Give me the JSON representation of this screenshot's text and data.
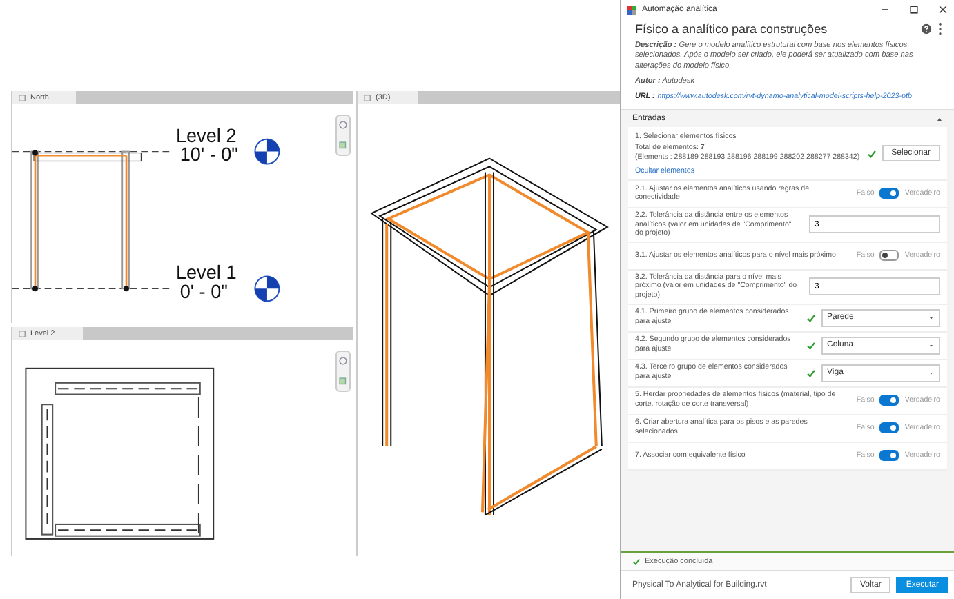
{
  "views": [
    {
      "kind": "elevation",
      "tab": "North",
      "levels": [
        {
          "name": "Level 2",
          "elevation": "10' - 0\""
        },
        {
          "name": "Level 1",
          "elevation": "0' - 0\""
        }
      ]
    },
    {
      "kind": "plan",
      "tab": "Level 2"
    },
    {
      "kind": "perspective",
      "tab": "(3D)"
    }
  ],
  "panel": {
    "window_title": "Automação analítica",
    "title": "Físico a analítico para construções",
    "description": "**Descrição :** Gere o modelo analítico estrutural com base nos elementos físicos selecionados. Após o modelo ser criado, ele poderá ser atualizado com base nas alterações do modelo físico.",
    "author": "**Autor :** Autodesk",
    "url_label": "URL :",
    "url": "https://www.autodesk.com/rvt-dynamo-analytical-model-scripts-help-2023-ptb",
    "section": {
      "title": "Entradas",
      "expanded": true
    },
    "inputs": [
      {
        "kind": "select",
        "label": "1. Selecionar elementos físicos",
        "total": "Total de elementos: **7**",
        "elements": "(Elements : 288189 288193 288196 288199 288202 288277 288342)",
        "link": "Ocultar elementos",
        "button": "Selecionar"
      },
      {
        "kind": "toggle",
        "label": "2.1. Ajustar os elementos analíticos usando regras de conectividade",
        "off_label": "Falso",
        "on_label": "Verdadeiro",
        "on": true
      },
      {
        "kind": "number",
        "label": "2.2. Tolerância da distância entre os elementos analíticos (valor em unidades de \"Comprimento\" do projeto)",
        "value": "3"
      },
      {
        "kind": "toggle",
        "label": "3.1. Ajustar os elementos analíticos para o nível mais próximo",
        "off_label": "Falso",
        "on_label": "Verdadeiro",
        "on": false
      },
      {
        "kind": "number",
        "label": "3.2. Tolerância da distância para o nível mais próximo (valor em unidades de \"Comprimento\" do projeto)",
        "value": "3"
      },
      {
        "kind": "dropdown",
        "label": "4.1. Primeiro grupo de elementos considerados para ajuste",
        "value": "Parede"
      },
      {
        "kind": "dropdown",
        "label": "4.2. Segundo grupo de elementos considerados para ajuste",
        "value": "Coluna"
      },
      {
        "kind": "dropdown",
        "label": "4.3. Terceiro grupo de elementos considerados para ajuste",
        "value": "Viga"
      },
      {
        "kind": "toggle",
        "label": "5. Herdar propriedades de elementos físicos (material, tipo de corte, rotação de corte transversal)",
        "off_label": "Falso",
        "on_label": "Verdadeiro",
        "on": true
      },
      {
        "kind": "toggle",
        "label": "6. Criar abertura analítica para os pisos e as paredes selecionados",
        "off_label": "Falso",
        "on_label": "Verdadeiro",
        "on": true
      },
      {
        "kind": "toggle",
        "label": "7. Associar com equivalente físico",
        "off_label": "Falso",
        "on_label": "Verdadeiro",
        "on": true
      }
    ],
    "status": "Execução concluída",
    "file": "Physical To Analytical for Building.rvt",
    "back_button": "Voltar",
    "run_button": "Executar"
  }
}
